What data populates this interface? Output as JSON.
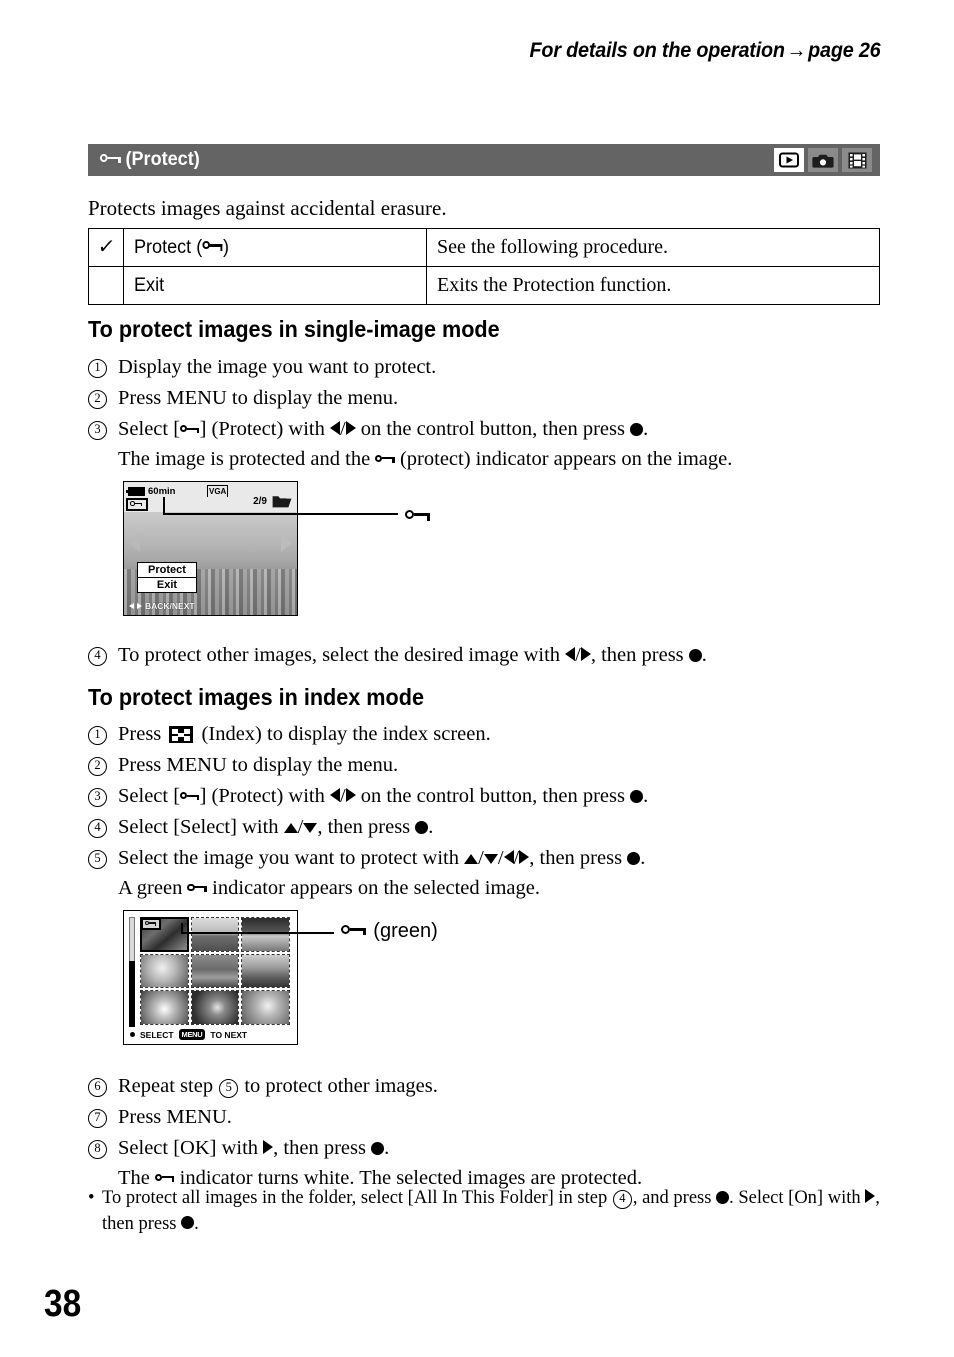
{
  "header": {
    "text_before": "For details on the operation",
    "arrow": "→",
    "text_after": "page 26"
  },
  "titlebar": {
    "icon": "key-icon",
    "label": "(Protect)",
    "mode_icons": [
      {
        "name": "playback-mode-icon",
        "active": true
      },
      {
        "name": "camera-mode-icon",
        "active": false
      },
      {
        "name": "movie-mode-icon",
        "active": false
      }
    ]
  },
  "intro": "Protects images against accidental erasure.",
  "options_table": {
    "rows": [
      {
        "checked": true,
        "check_glyph": "✓",
        "name_prefix": "Protect (",
        "name_suffix": ")",
        "name_icon": "key-icon",
        "description": "See the following procedure."
      },
      {
        "checked": false,
        "check_glyph": "",
        "name_prefix": "Exit",
        "name_suffix": "",
        "name_icon": "",
        "description": "Exits the Protection function."
      }
    ]
  },
  "single_mode": {
    "heading": "To protect images in single-image mode",
    "steps": [
      {
        "num": "1",
        "text": "Display the image you want to protect."
      },
      {
        "num": "2",
        "text": "Press MENU to display the menu."
      },
      {
        "num": "3",
        "text_a": "Select [",
        "text_b": "] (Protect) with ",
        "text_c": " on the control button, then press ",
        "text_d": ".",
        "sub_a": "The image is protected and the ",
        "sub_b": " (protect) indicator appears on the image."
      },
      {
        "num": "4",
        "text_a": "To protect other images, select the desired image with ",
        "text_b": ", then press ",
        "text_c": "."
      }
    ]
  },
  "lcd_single": {
    "battery_time": "60min",
    "image_size": "VGA",
    "counter": "2/9",
    "indicator_icon": "key-icon",
    "menu_items": [
      "Protect",
      "Exit"
    ],
    "hint": "BACK/NEXT",
    "callout_icon": "key-icon"
  },
  "index_mode": {
    "heading": "To protect images in index mode",
    "steps": [
      {
        "num": "1",
        "text_a": "Press ",
        "text_b": " (Index) to display the index screen."
      },
      {
        "num": "2",
        "text": "Press MENU to display the menu."
      },
      {
        "num": "3",
        "text_a": "Select [",
        "text_b": "] (Protect) with ",
        "text_c": " on the control button, then press ",
        "text_d": "."
      },
      {
        "num": "4",
        "text_a": "Select [Select] with ",
        "text_b": ", then press ",
        "text_c": "."
      },
      {
        "num": "5",
        "text_a": "Select the image you want to protect with ",
        "text_b": ", then press ",
        "text_c": ".",
        "sub_a": "A green ",
        "sub_b": " indicator appears on the selected image."
      },
      {
        "num": "6",
        "text_a": "Repeat step ",
        "ref": "5",
        "text_b": " to protect other images."
      },
      {
        "num": "7",
        "text": "Press MENU."
      },
      {
        "num": "8",
        "text_a": "Select [OK] with ",
        "text_b": ", then press ",
        "text_c": ".",
        "sub_a": "The ",
        "sub_b": " indicator turns white. The selected images are protected."
      }
    ],
    "note": {
      "bullet": "•",
      "text_a": "To protect all images in the folder, select [All In This Folder] in step ",
      "ref": "4",
      "text_b": ", and press ",
      "text_c": ". Select [On] with ",
      "text_d": ",",
      "text_e": "then press ",
      "text_f": "."
    }
  },
  "lcd_index": {
    "indicator_icon": "key-icon",
    "hint_select": "SELECT",
    "hint_menu_chip": "MENU",
    "hint_next": "TO NEXT",
    "callout_icon": "key-icon",
    "callout_label": "(green)",
    "thumbnail_count": 9,
    "selected_index": 0
  },
  "page_number": "38",
  "colors": {
    "titlebar_bg": "#646464",
    "mode_icon_bg": "#8a8a8a",
    "mode_icon_active_bg": "#ffffff",
    "text": "#000000"
  }
}
